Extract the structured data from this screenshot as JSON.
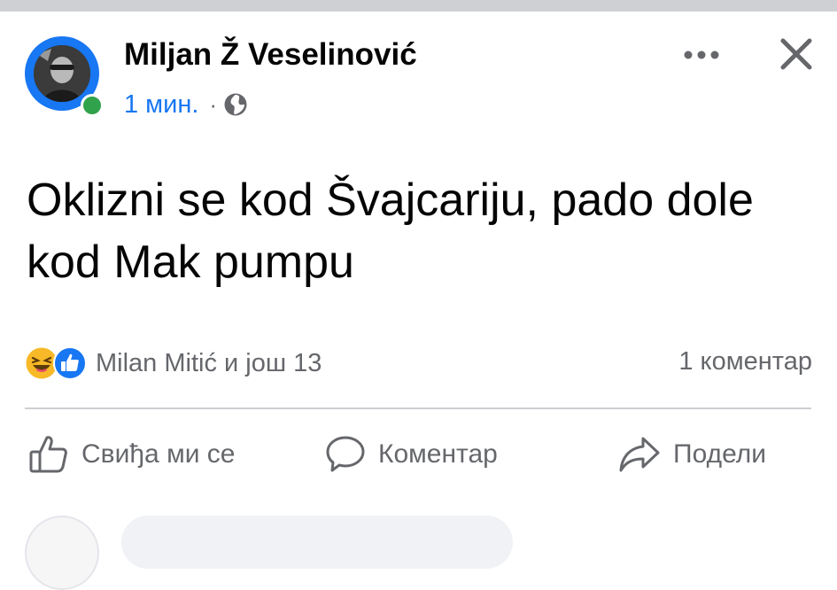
{
  "post": {
    "author": "Miljan Ž Veselinović",
    "time": "1 мин.",
    "separator": "·",
    "privacy_icon": "globe-icon",
    "text": "Oklizni se kod Švajcariju, pado dole kod Mak pumpu"
  },
  "header_icons": {
    "more": "more-horizontal-icon",
    "close": "close-icon"
  },
  "reactions": {
    "icons": [
      "haha-emoji",
      "like-icon"
    ],
    "summary": "Milan Mitić и још 13",
    "comments": "1 коментар"
  },
  "actions": {
    "like": "Свиђа ми се",
    "comment": "Коментар",
    "share": "Подели"
  },
  "colors": {
    "accent": "#1877f2",
    "online": "#31a24c",
    "secondary_text": "#65676b",
    "primary_text": "#050505"
  }
}
